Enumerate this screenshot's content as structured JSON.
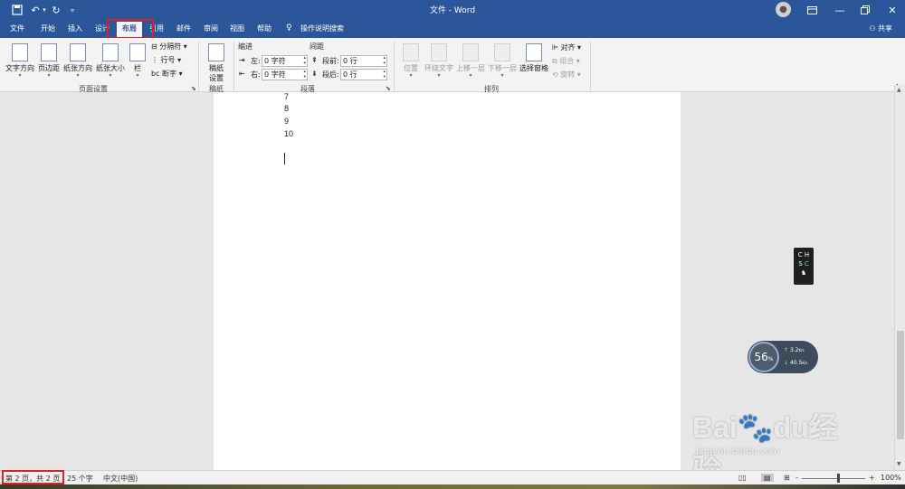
{
  "titlebar": {
    "title": "文件 - Word",
    "save_icon": "save-icon",
    "undo_icon": "undo-icon",
    "redo_icon": "redo-icon",
    "customize_icon": "customize-qat-icon"
  },
  "tabs": [
    "文件",
    "开始",
    "插入",
    "设计",
    "布局",
    "引用",
    "邮件",
    "审阅",
    "视图",
    "帮助"
  ],
  "active_tab": "布局",
  "tell_me": "操作说明搜索",
  "share": "共享",
  "ribbon": {
    "page_setup": {
      "text_direction": "文字方向",
      "margins": "页边距",
      "orientation": "纸张方向",
      "size": "纸张大小",
      "columns": "栏",
      "breaks": "分隔符",
      "line_numbers": "行号",
      "hyphenation": "断字",
      "group_label": "页面设置"
    },
    "manuscript": {
      "settings_line1": "稿纸",
      "settings_line2": "设置",
      "group_label": "稿纸"
    },
    "paragraph": {
      "indent_label": "缩进",
      "spacing_label": "间距",
      "left_label": "左:",
      "right_label": "右:",
      "left_value": "0 字符",
      "right_value": "0 字符",
      "before_label": "段前:",
      "after_label": "段后:",
      "before_value": "0 行",
      "after_value": "0 行",
      "group_label": "段落"
    },
    "arrange": {
      "position": "位置",
      "wrap_text": "环绕文字",
      "bring_forward": "上移一层",
      "send_backward": "下移一层",
      "selection_pane": "选择窗格",
      "align": "对齐",
      "group": "组合",
      "rotate": "旋转",
      "group_label": "排列"
    }
  },
  "document": {
    "lines": [
      "7",
      "8",
      "9",
      "10"
    ]
  },
  "ime": {
    "line1": "C H",
    "line2": "S ",
    "line2_accent": "C"
  },
  "net_monitor": {
    "percent": "56",
    "percent_unit": "%",
    "up": "3.2",
    "down": "40.5",
    "unit": "K/s"
  },
  "watermark": {
    "brand": "Bai",
    "brand_tail": "du",
    "brand_cn": "经验",
    "url": "jingyan.baidu.com"
  },
  "statusbar": {
    "page": "第 2 页，共 2 页",
    "words": "25 个字",
    "language": "中文(中国)",
    "zoom_out": "-",
    "zoom_in": "+",
    "zoom": "100%"
  },
  "colors": {
    "title_bar": "#2b579a",
    "highlight_box": "#e02020",
    "ribbon_bg": "#f3f3f3"
  }
}
